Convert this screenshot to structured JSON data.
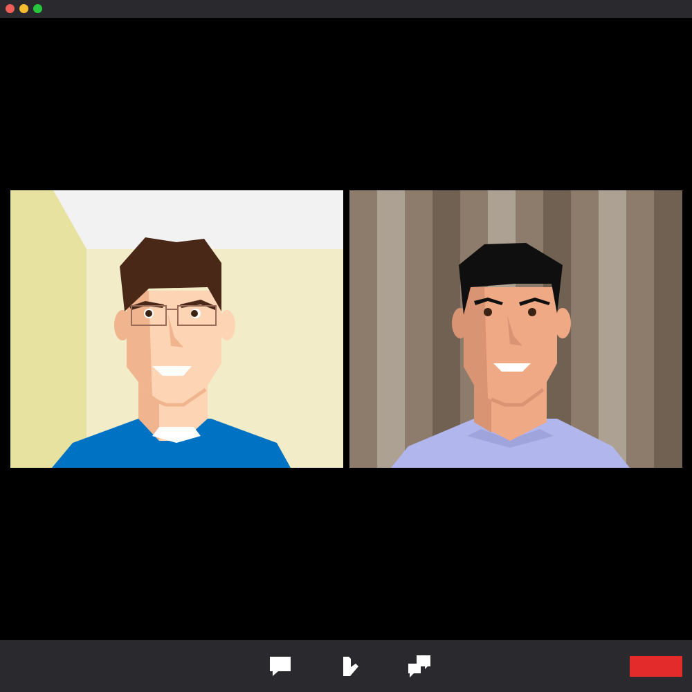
{
  "window": {
    "controls": [
      {
        "name": "close",
        "color": "#ed5f56"
      },
      {
        "name": "minimize",
        "color": "#f5bd2e"
      },
      {
        "name": "maximize",
        "color": "#27c63f"
      }
    ]
  },
  "participants": [
    {
      "id": "left",
      "shirt_color": "#0072c4",
      "hair_color": "#4a2818",
      "skin_color": "#fdd5b5",
      "glasses": true,
      "background": "room-corner"
    },
    {
      "id": "right",
      "shirt_color": "#b1b6ec",
      "hair_color": "#0f0f0f",
      "skin_color": "#f0a985",
      "glasses": false,
      "background": "striped-curtain"
    }
  ],
  "toolbar": {
    "buttons": [
      {
        "name": "chat-icon"
      },
      {
        "name": "raise-hand-icon"
      },
      {
        "name": "screen-share-icon"
      }
    ],
    "end_call_color": "#e42b2b",
    "background": "#2a2a2e"
  }
}
